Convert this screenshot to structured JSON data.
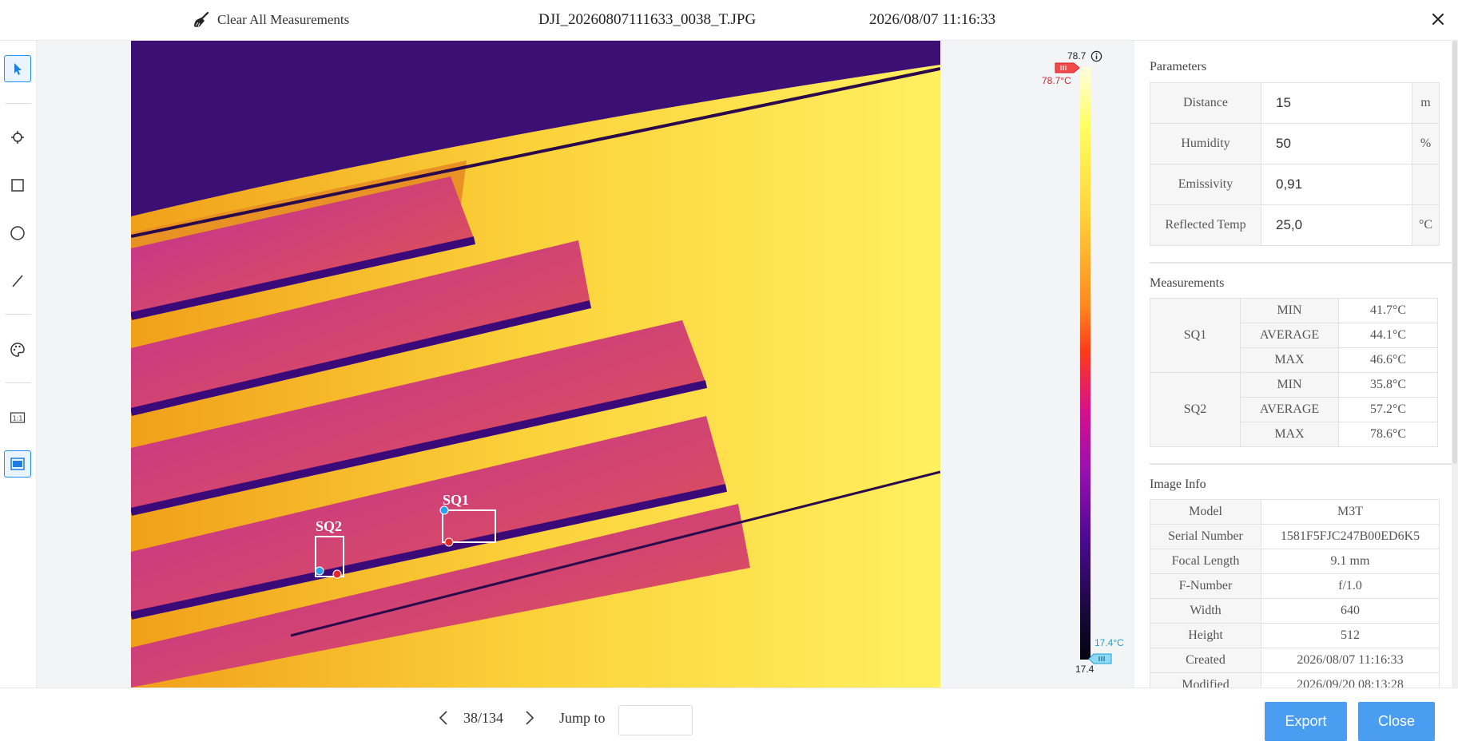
{
  "header": {
    "clear_label": "Clear All Measurements",
    "file_name": "DJI_20260807111633_0038_T.JPG",
    "timestamp": "2026/08/07 11:16:33"
  },
  "toolbar": {
    "items": [
      "pointer-icon",
      "crosshair-icon",
      "rectangle-icon",
      "circle-icon",
      "line-icon",
      "palette-icon",
      "one-to-one-icon",
      "display-mode-icon"
    ]
  },
  "scale": {
    "max_value": "78.7",
    "max_label": "78.7°C",
    "min_value": "17.4",
    "min_label": "17.4°C",
    "max_color": "#d6222a",
    "min_color": "#1aa3d9"
  },
  "boxes": {
    "sq1": "SQ1",
    "sq2": "SQ2"
  },
  "parameters": {
    "title": "Parameters",
    "rows": [
      {
        "label": "Distance",
        "value": "15",
        "unit": "m"
      },
      {
        "label": "Humidity",
        "value": "50",
        "unit": "%"
      },
      {
        "label": "Emissivity",
        "value": "0,91",
        "unit": ""
      },
      {
        "label": "Reflected Temp",
        "value": "25,0",
        "unit": "°C"
      }
    ]
  },
  "measurements": {
    "title": "Measurements",
    "sq1": {
      "name": "SQ1",
      "min_key": "MIN",
      "min": "41.7°C",
      "avg_key": "AVERAGE",
      "avg": "44.1°C",
      "max_key": "MAX",
      "max": "46.6°C"
    },
    "sq2": {
      "name": "SQ2",
      "min_key": "MIN",
      "min": "35.8°C",
      "avg_key": "AVERAGE",
      "avg": "57.2°C",
      "max_key": "MAX",
      "max": "78.6°C"
    }
  },
  "image_info": {
    "title": "Image Info",
    "rows": [
      {
        "key": "Model",
        "value": "M3T"
      },
      {
        "key": "Serial Number",
        "value": "1581F5FJC247B00ED6K5"
      },
      {
        "key": "Focal Length",
        "value": "9.1 mm"
      },
      {
        "key": "F-Number",
        "value": "f/1.0"
      },
      {
        "key": "Width",
        "value": "640"
      },
      {
        "key": "Height",
        "value": "512"
      },
      {
        "key": "Created",
        "value": "2026/08/07 11:16:33"
      },
      {
        "key": "Modified",
        "value": "2026/09/20 08:13:28"
      }
    ]
  },
  "footer": {
    "pager": "38/134",
    "jump_label": "Jump to",
    "jump_value": "",
    "export_label": "Export",
    "close_label": "Close"
  }
}
